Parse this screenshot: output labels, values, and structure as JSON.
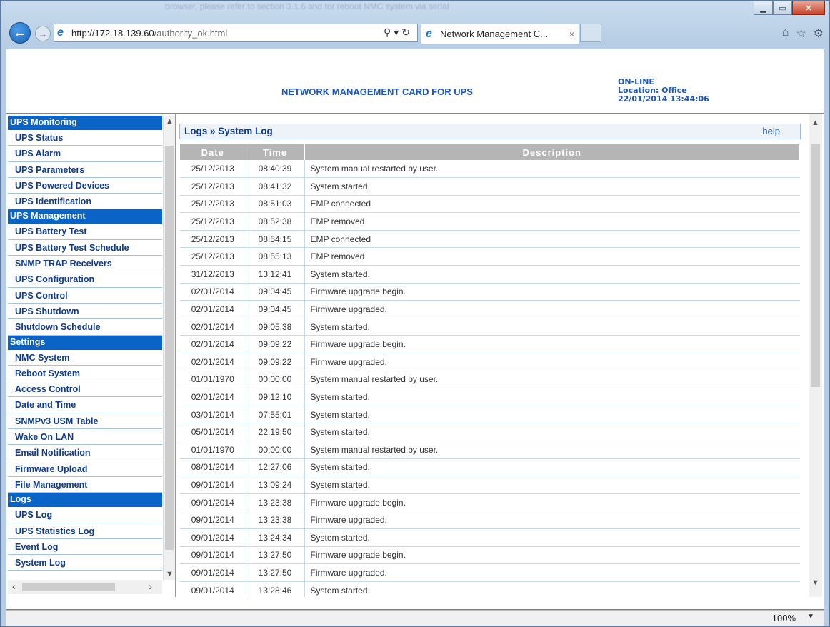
{
  "browser": {
    "url_host": "http://172.18.139.60",
    "url_path": "/authority_ok.html",
    "tab_title": "Network Management C...",
    "tab_close": "×",
    "zoom": "100%",
    "titlebar_ghost": "browser, please refer to section 3.1.6 and for reboot NMC system via serial"
  },
  "header": {
    "title": "NETWORK MANAGEMENT CARD FOR UPS",
    "status": "ON-LINE",
    "location": "Location: Office",
    "datetime": "22/01/2014 13:44:06"
  },
  "menu": {
    "sections": [
      {
        "title": "UPS Monitoring",
        "items": [
          "UPS Status",
          "UPS Alarm",
          "UPS Parameters",
          "UPS Powered Devices",
          "UPS Identification"
        ]
      },
      {
        "title": "UPS Management",
        "items": [
          "UPS Battery Test",
          "UPS Battery Test Schedule",
          "SNMP TRAP Receivers",
          "UPS Configuration",
          "UPS Control",
          "UPS Shutdown",
          "Shutdown Schedule"
        ]
      },
      {
        "title": "Settings",
        "items": [
          "NMC System",
          "Reboot System",
          "Access Control",
          "Date and Time",
          "SNMPv3 USM Table",
          "Wake On LAN",
          "Email Notification",
          "Firmware Upload",
          "File Management"
        ]
      },
      {
        "title": "Logs",
        "items": [
          "UPS Log",
          "UPS Statistics Log",
          "Event Log",
          "System Log"
        ]
      }
    ]
  },
  "log": {
    "breadcrumb": "Logs » System Log",
    "help": "help",
    "columns": [
      "Date",
      "Time",
      "Description"
    ],
    "rows": [
      [
        "25/12/2013",
        "08:40:39",
        "System manual restarted by user."
      ],
      [
        "25/12/2013",
        "08:41:32",
        "System started."
      ],
      [
        "25/12/2013",
        "08:51:03",
        "EMP connected"
      ],
      [
        "25/12/2013",
        "08:52:38",
        "EMP removed"
      ],
      [
        "25/12/2013",
        "08:54:15",
        "EMP connected"
      ],
      [
        "25/12/2013",
        "08:55:13",
        "EMP removed"
      ],
      [
        "31/12/2013",
        "13:12:41",
        "System started."
      ],
      [
        "02/01/2014",
        "09:04:45",
        "Firmware upgrade begin."
      ],
      [
        "02/01/2014",
        "09:04:45",
        "Firmware upgraded."
      ],
      [
        "02/01/2014",
        "09:05:38",
        "System started."
      ],
      [
        "02/01/2014",
        "09:09:22",
        "Firmware upgrade begin."
      ],
      [
        "02/01/2014",
        "09:09:22",
        "Firmware upgraded."
      ],
      [
        "01/01/1970",
        "00:00:00",
        "System manual restarted by user."
      ],
      [
        "02/01/2014",
        "09:12:10",
        "System started."
      ],
      [
        "03/01/2014",
        "07:55:01",
        "System started."
      ],
      [
        "05/01/2014",
        "22:19:50",
        "System started."
      ],
      [
        "01/01/1970",
        "00:00:00",
        "System manual restarted by user."
      ],
      [
        "08/01/2014",
        "12:27:06",
        "System started."
      ],
      [
        "09/01/2014",
        "13:09:24",
        "System started."
      ],
      [
        "09/01/2014",
        "13:23:38",
        "Firmware upgrade begin."
      ],
      [
        "09/01/2014",
        "13:23:38",
        "Firmware upgraded."
      ],
      [
        "09/01/2014",
        "13:24:34",
        "System started."
      ],
      [
        "09/01/2014",
        "13:27:50",
        "Firmware upgrade begin."
      ],
      [
        "09/01/2014",
        "13:27:50",
        "Firmware upgraded."
      ],
      [
        "09/01/2014",
        "13:28:46",
        "System started."
      ]
    ]
  }
}
